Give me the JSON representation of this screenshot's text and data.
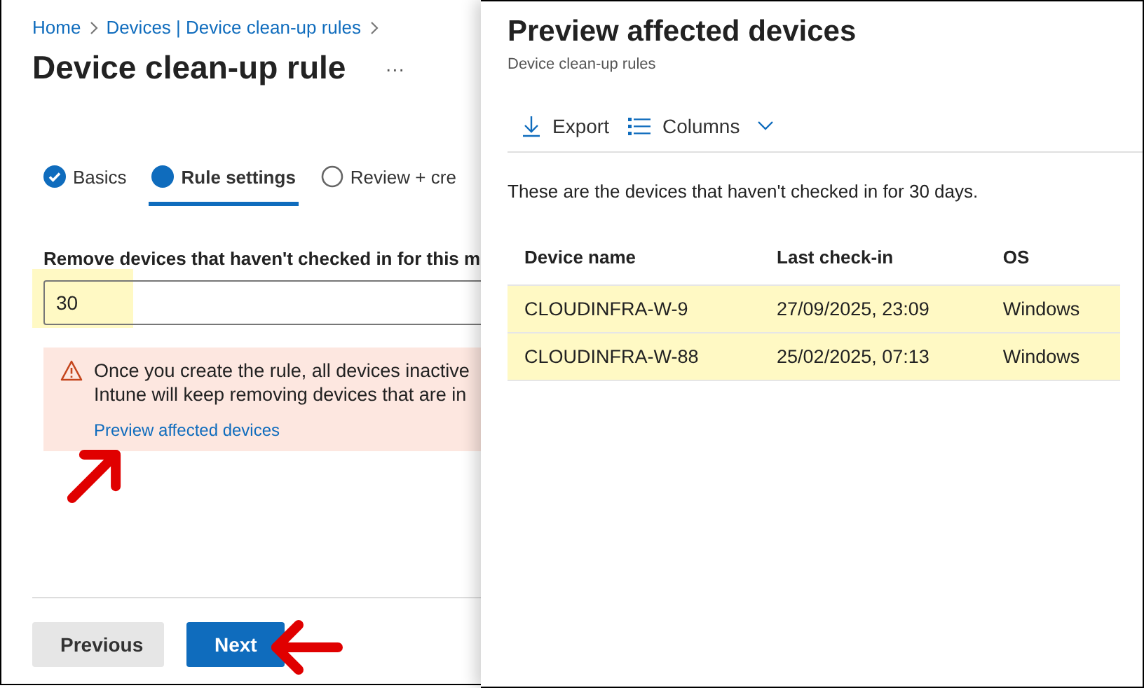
{
  "breadcrumb": [
    "Home",
    "Devices | Device clean-up rules"
  ],
  "page_title": "Device clean-up rule",
  "more_label": "···",
  "steps": [
    {
      "label": "Basics",
      "kind": "done",
      "selected": false
    },
    {
      "label": "Rule settings",
      "kind": "current",
      "selected": true
    },
    {
      "label": "Review + cre",
      "kind": "pending",
      "selected": false
    }
  ],
  "field": {
    "label": "Remove devices that haven't checked in for this m",
    "value": "30",
    "highlighted": true
  },
  "warning": {
    "lines": [
      "Once you create the rule, all devices inactive",
      "Intune will keep removing devices that are in"
    ],
    "link": "Preview affected devices"
  },
  "buttons": [
    {
      "label": "Previous",
      "kind": "secondary"
    },
    {
      "label": "Next",
      "kind": "primary"
    }
  ],
  "panel": {
    "title": "Preview affected devices",
    "subtitle": "Device clean-up rules",
    "toolbar": [
      {
        "label": "Export",
        "kind": "export"
      },
      {
        "label": "Columns",
        "kind": "columns"
      }
    ],
    "description": "These are the devices that haven't checked in for 30 days.",
    "columns": [
      "Device name",
      "Last check-in",
      "OS"
    ],
    "rows": [
      {
        "cells": [
          "CLOUDINFRA-W-9",
          "27/09/2025, 23:09",
          "Windows"
        ],
        "highlighted": true
      },
      {
        "cells": [
          "CLOUDINFRA-W-88",
          "25/02/2025, 07:13",
          "Windows"
        ],
        "highlighted": true
      }
    ]
  }
}
